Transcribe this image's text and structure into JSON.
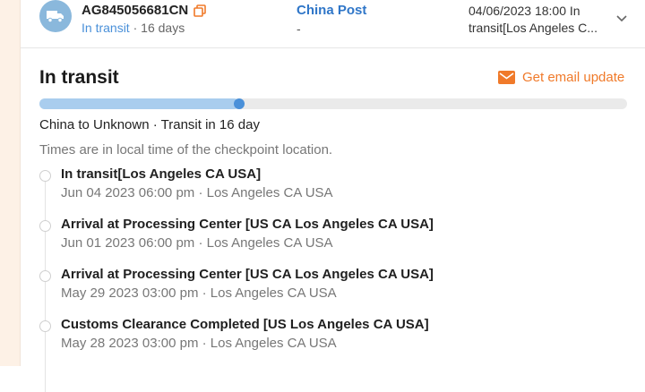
{
  "package": {
    "tracking_number": "AG845056681CN",
    "status": "In transit",
    "status_separator": " · ",
    "days": "16 days",
    "carrier": "China Post",
    "carrier_sub": "-",
    "latest_time": "04/06/2023 18:00 In",
    "latest_desc": "transit[Los Angeles C..."
  },
  "detail": {
    "title": "In transit",
    "email_update_label": "Get email update",
    "progress_fraction": 0.34,
    "route": "China to Unknown · Transit in 16 day",
    "note": "Times are in local time of the checkpoint location."
  },
  "events": [
    {
      "desc": "In transit[Los Angeles CA USA]",
      "meta": "Jun 04 2023 06:00 pm · Los Angeles CA USA"
    },
    {
      "desc": "Arrival at Processing Center [US CA Los Angeles CA USA]",
      "meta": "Jun 01 2023 06:00 pm · Los Angeles CA USA"
    },
    {
      "desc": "Arrival at Processing Center [US CA Los Angeles CA USA]",
      "meta": "May 29 2023 03:00 pm · Los Angeles CA USA"
    },
    {
      "desc": "Customs Clearance Completed [US Los Angeles CA USA]",
      "meta": "May 28 2023 03:00 pm · Los Angeles CA USA"
    }
  ],
  "colors": {
    "accent_blue": "#4a90d9",
    "carrier_blue": "#2f76c8",
    "email_orange": "#f07a2a",
    "progress_fill": "#a9cdee"
  },
  "icons": {
    "avatar": "truck-icon",
    "copy": "copy-icon",
    "expand": "chevron-down-icon",
    "email": "mail-icon"
  }
}
